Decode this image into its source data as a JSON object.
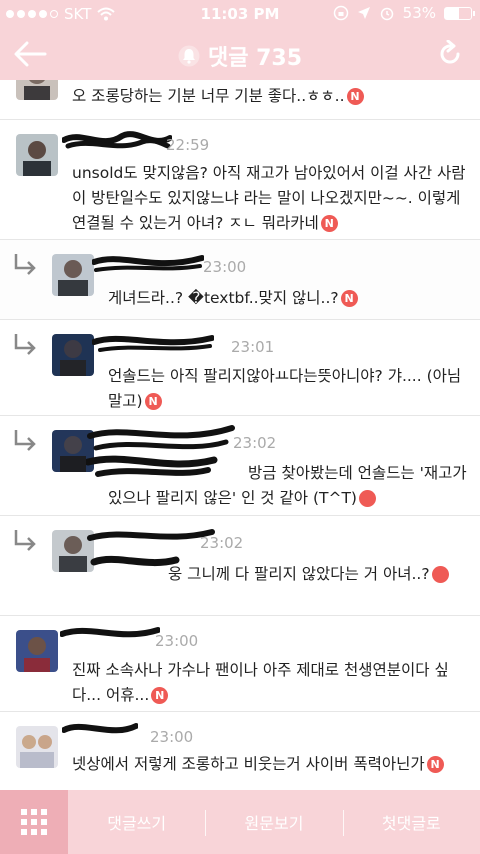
{
  "status": {
    "carrier": "SKT",
    "time": "11:03 PM",
    "battery": "53%",
    "battery_level": 0.53
  },
  "header": {
    "title": "댓글 735"
  },
  "comments": [
    {
      "text": "오 조롱당하는 기분 너무 기분 좋다..ㅎㅎ.."
    },
    {
      "time": "22:59",
      "text": "unsold도 맞지않음? 아직 재고가 남아있어서 이걸 사간 사람이 방탄일수도 있지않느냐 라는 말이 나오겠지만~~. 이렇게 연결될 수 있는거 아녀? ㅈㄴ 뭐라카네"
    },
    {
      "time": "23:00",
      "text": "게녀드라..? �textbf..맞지 않니..?"
    },
    {
      "time": "23:01",
      "text": "언솔드는 아직 팔리지않아ㅛ다는뜻아니야? 갸.... (아님말고)"
    },
    {
      "time": "23:02",
      "text": "방금 찾아봤는데 언솔드는 '재고가 있으나 팔리지 않은' 인 것 같아 (T^T)"
    },
    {
      "time": "23:02",
      "text": "웅 그니께 다 팔리지 않았다는 거 아녀..?"
    },
    {
      "time": "23:00",
      "text": "진짜 소속사나 가수나 팬이나 아주 제대로 천생연분이다 싶다... 어휴..."
    },
    {
      "time": "23:00",
      "text": "넷상에서 저렇게 조롱하고 비웃는거 사이버 폭력아닌가"
    }
  ],
  "badge": "N",
  "bottom": {
    "write": "댓글쓰기",
    "original": "원문보기",
    "first": "첫댓글로"
  },
  "colors": {
    "pink": "#f8d4d8",
    "pink_dark": "#eeaeb6",
    "badge": "#ef5a55"
  }
}
